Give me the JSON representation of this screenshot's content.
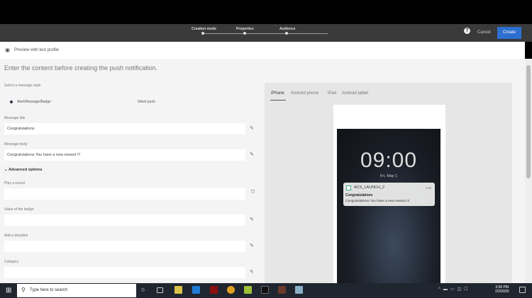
{
  "header": {
    "steps": [
      "Creation mode",
      "Properties",
      "Audience"
    ],
    "help": "?",
    "cancel": "Cancel",
    "create": "Create"
  },
  "preview": {
    "icon": "eye-icon",
    "label": "Preview with test profile"
  },
  "form": {
    "title": "Enter the content before creating the push notification.",
    "style_label": "Select a message style",
    "style_options": [
      "Alert/Message/Badge",
      "Silent push"
    ],
    "message_title_label": "Message title",
    "message_title": "Congratulations",
    "message_body_label": "Message body",
    "message_body": "Congratulations You have a new reward !!!",
    "advanced": "Advanced options",
    "sound_label": "Play a sound",
    "badge_label": "Value of the badge",
    "deeplink_label": "Add a deeplink",
    "category_label": "Category"
  },
  "device_tabs": [
    "iPhone",
    "Android phone",
    "iPad",
    "Android tablet"
  ],
  "phone": {
    "time": "09:00",
    "date": "Fri, May 1",
    "notif_app": "ACS_LAUNCH_2",
    "notif_time": "now",
    "notif_title": "Congratulations",
    "notif_body": "Congratulations You have a new reward !!!"
  },
  "taskbar": {
    "search_placeholder": "Type here to search",
    "time": "3:50 PM",
    "date": "2/3/2020"
  }
}
